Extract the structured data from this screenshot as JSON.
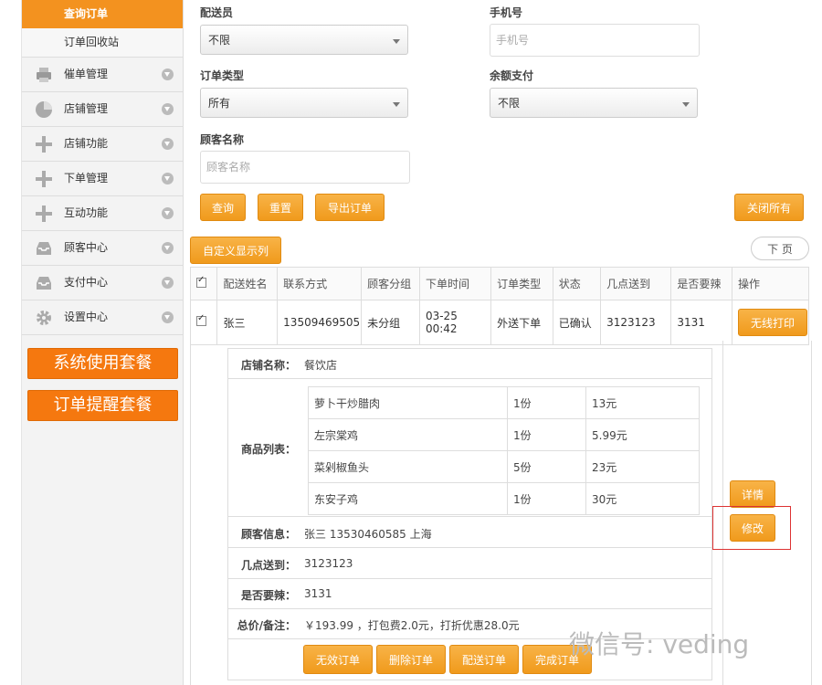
{
  "sidebar": {
    "sub_items": [
      {
        "label": "查询订单",
        "active": true
      },
      {
        "label": "订单回收站",
        "active": false
      }
    ],
    "menu": [
      {
        "label": "催单管理",
        "icon": "printer-icon"
      },
      {
        "label": "店铺管理",
        "icon": "pie-chart-icon"
      },
      {
        "label": "店铺功能",
        "icon": "plus-icon"
      },
      {
        "label": "下单管理",
        "icon": "plus-icon"
      },
      {
        "label": "互动功能",
        "icon": "plus-icon"
      },
      {
        "label": "顾客中心",
        "icon": "inbox-icon"
      },
      {
        "label": "支付中心",
        "icon": "inbox-icon"
      },
      {
        "label": "设置中心",
        "icon": "gear-icon"
      }
    ],
    "package_buttons": [
      "系统使用套餐",
      "订单提醒套餐"
    ]
  },
  "filters": {
    "courier": {
      "label": "配送员",
      "value": "不限"
    },
    "phone": {
      "label": "手机号",
      "placeholder": "手机号"
    },
    "order_type": {
      "label": "订单类型",
      "value": "所有"
    },
    "balance_pay": {
      "label": "余额支付",
      "value": "不限"
    },
    "customer_name": {
      "label": "顾客名称",
      "placeholder": "顾客名称"
    }
  },
  "actions": {
    "query": "查询",
    "reset": "重置",
    "export": "导出订单",
    "close_all": "关闭所有",
    "custom_columns": "自定义显示列",
    "next_page": "下 页"
  },
  "table": {
    "headers": [
      "配送姓名",
      "联系方式",
      "顾客分组",
      "下单时间",
      "订单类型",
      "状态",
      "几点送到",
      "是否要辣",
      "操作"
    ],
    "row": {
      "name": "张三",
      "phone": "13509469505",
      "group": "未分组",
      "time": "03-25 00:42",
      "type": "外送下单",
      "status": "已确认",
      "delivery_time": "3123123",
      "spicy": "3131",
      "action": "无线打印"
    }
  },
  "detail": {
    "shop_label": "店铺名称：",
    "shop_value": "餐饮店",
    "goods_label": "商品列表：",
    "goods": [
      {
        "name": "萝卜干炒腊肉",
        "qty": "1份",
        "price": "13元"
      },
      {
        "name": "左宗棠鸡",
        "qty": "1份",
        "price": "5.99元"
      },
      {
        "name": "菜剁椒鱼头",
        "qty": "5份",
        "price": "23元"
      },
      {
        "name": "东安子鸡",
        "qty": "1份",
        "price": "30元"
      }
    ],
    "customer_label": "顾客信息：",
    "customer_value": "张三   13530460585   上海",
    "delivery_label": "几点送到：",
    "delivery_value": "3123123",
    "spicy_label": "是否要辣：",
    "spicy_value": "3131",
    "total_label": "总价/备注：",
    "total_value": "￥193.99 ，打包费2.0元，打折优惠28.0元",
    "buttons": [
      "无效订单",
      "删除订单",
      "配送订单",
      "完成订单"
    ],
    "side_buttons": [
      "详情",
      "修改"
    ]
  },
  "watermark": "微信号: veding"
}
